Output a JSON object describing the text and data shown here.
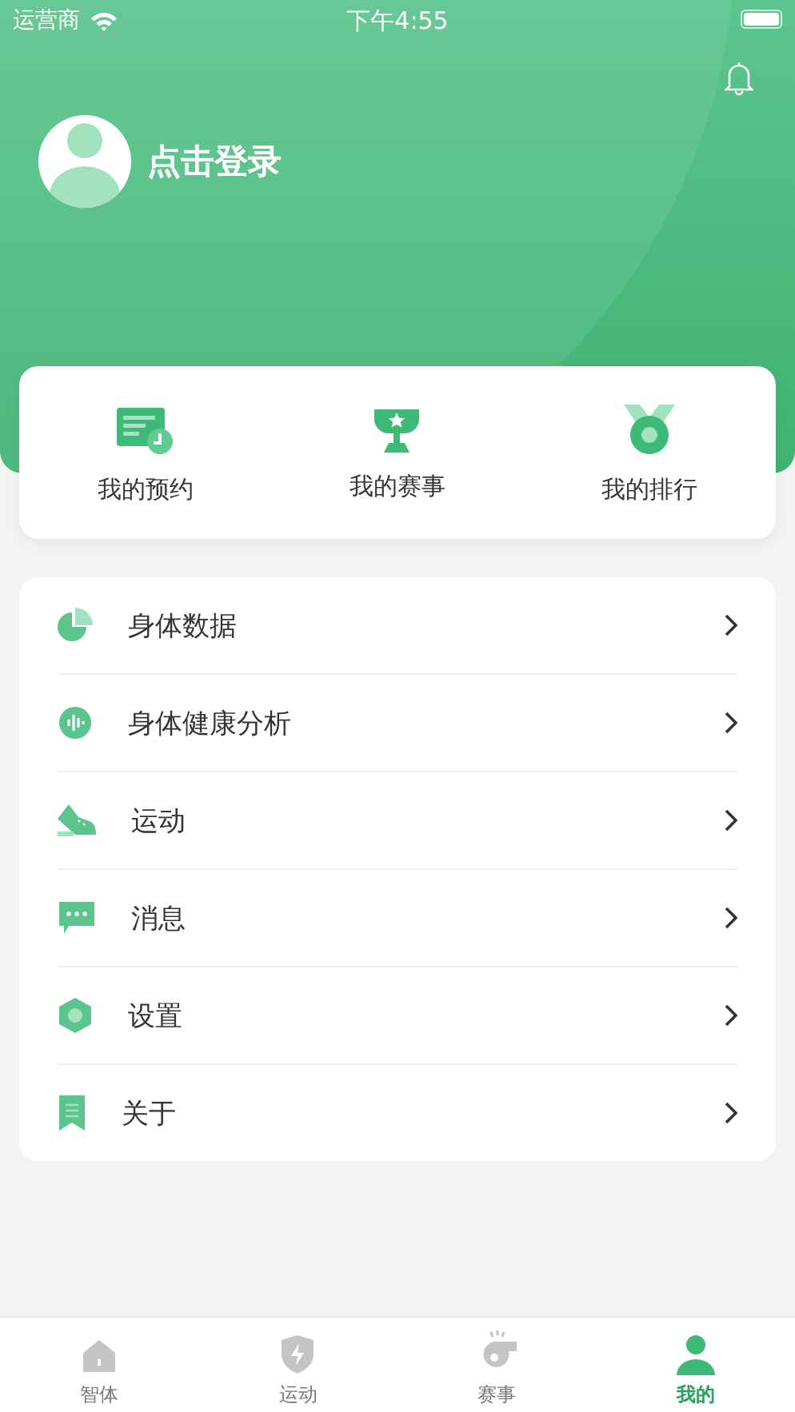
{
  "status_bar": {
    "carrier": "运营商",
    "time": "下午4:55"
  },
  "profile": {
    "login_label": "点击登录"
  },
  "shortcuts": [
    {
      "kind": "booking",
      "label": "我的预约"
    },
    {
      "kind": "trophy",
      "label": "我的赛事"
    },
    {
      "kind": "medal",
      "label": "我的排行"
    }
  ],
  "menu": [
    {
      "kind": "pie",
      "label": "身体数据"
    },
    {
      "kind": "wave",
      "label": "身体健康分析"
    },
    {
      "kind": "shoe",
      "label": "运动"
    },
    {
      "kind": "chat",
      "label": "消息"
    },
    {
      "kind": "hexagon",
      "label": "设置"
    },
    {
      "kind": "bookmark",
      "label": "关于"
    }
  ],
  "tab_bar": [
    {
      "kind": "home",
      "label": "智体",
      "selected": false
    },
    {
      "kind": "shield",
      "label": "运动",
      "selected": false
    },
    {
      "kind": "whistle",
      "label": "赛事",
      "selected": false
    },
    {
      "kind": "person",
      "label": "我的",
      "selected": true
    }
  ]
}
